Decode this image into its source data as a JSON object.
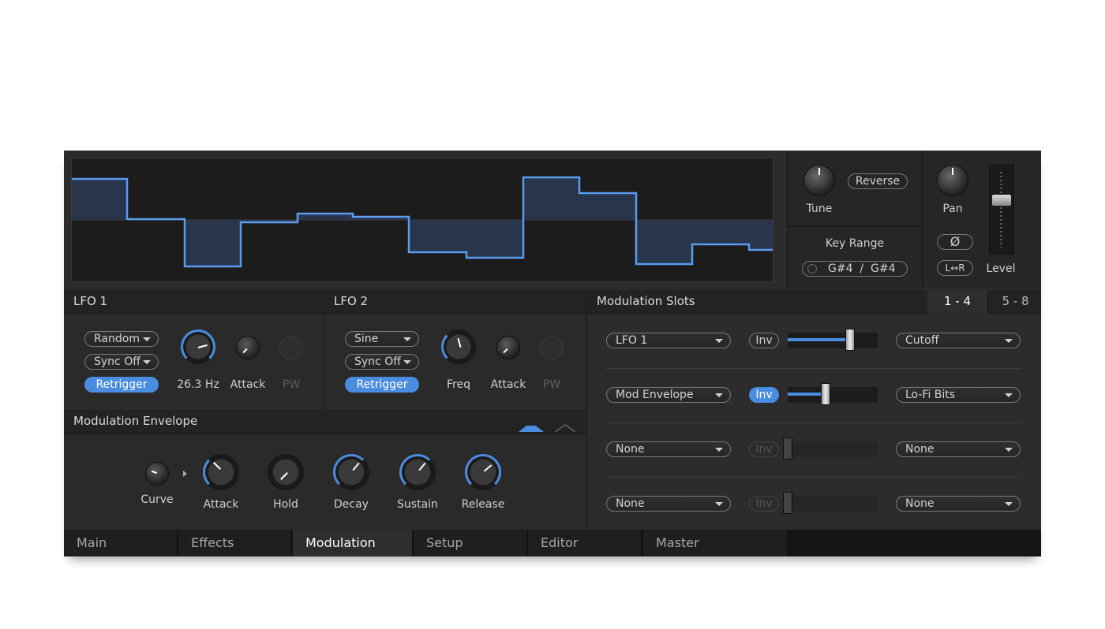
{
  "waveform": {
    "points": [
      [
        0,
        26
      ],
      [
        70,
        26
      ],
      [
        70,
        77
      ],
      [
        143,
        77
      ],
      [
        143,
        137
      ],
      [
        214,
        137
      ],
      [
        214,
        81
      ],
      [
        286,
        81
      ],
      [
        286,
        70
      ],
      [
        356,
        70
      ],
      [
        356,
        74
      ],
      [
        427,
        74
      ],
      [
        427,
        119
      ],
      [
        500,
        119
      ],
      [
        500,
        126
      ],
      [
        572,
        126
      ],
      [
        572,
        24
      ],
      [
        643,
        24
      ],
      [
        643,
        44
      ],
      [
        715,
        44
      ],
      [
        715,
        134
      ],
      [
        786,
        134
      ],
      [
        786,
        109
      ],
      [
        858,
        109
      ],
      [
        858,
        116
      ],
      [
        888,
        116
      ]
    ],
    "line_color": "#5a9cf0"
  },
  "top_right": {
    "tune_label": "Tune",
    "reverse_label": "Reverse",
    "key_range_label": "Key Range",
    "key_range_value": "G#4  /  G#4",
    "pan_label": "Pan",
    "phase_symbol": "Ø",
    "lr_label": "L↔R",
    "level_label": "Level",
    "level_value": 0.62
  },
  "lfo1": {
    "title": "LFO 1",
    "wave": "Random",
    "sync": "Sync Off",
    "retrigger": "Retrigger",
    "freq_value": "26.3 Hz",
    "attack_label": "Attack",
    "pw_label": "PW"
  },
  "lfo2": {
    "title": "LFO 2",
    "wave": "Sine",
    "sync": "Sync Off",
    "retrigger": "Retrigger",
    "freq_label": "Freq",
    "attack_label": "Attack",
    "pw_label": "PW"
  },
  "mod_env": {
    "title": "Modulation Envelope",
    "knobs": [
      "Curve",
      "Attack",
      "Hold",
      "Decay",
      "Sustain",
      "Release"
    ]
  },
  "mod_slots": {
    "title": "Modulation Slots",
    "tab_1_4": "1 - 4",
    "tab_5_8": "5 - 8",
    "slots": [
      {
        "source": "LFO 1",
        "inv": "Inv",
        "inv_active": false,
        "amount": 0.69,
        "target": "Cutoff",
        "enabled": true
      },
      {
        "source": "Mod Envelope",
        "inv": "Inv",
        "inv_active": true,
        "amount": 0.42,
        "target": "Lo-Fi Bits",
        "enabled": true
      },
      {
        "source": "None",
        "inv": "Inv",
        "inv_active": false,
        "amount": 0.0,
        "target": "None",
        "enabled": false
      },
      {
        "source": "None",
        "inv": "Inv",
        "inv_active": false,
        "amount": 0.0,
        "target": "None",
        "enabled": false
      }
    ]
  },
  "tabs": [
    "Main",
    "Effects",
    "Modulation",
    "Setup",
    "Editor",
    "Master"
  ],
  "active_tab": "Modulation",
  "colors": {
    "accent": "#4a8de0",
    "panel": "#2a2a2a"
  }
}
